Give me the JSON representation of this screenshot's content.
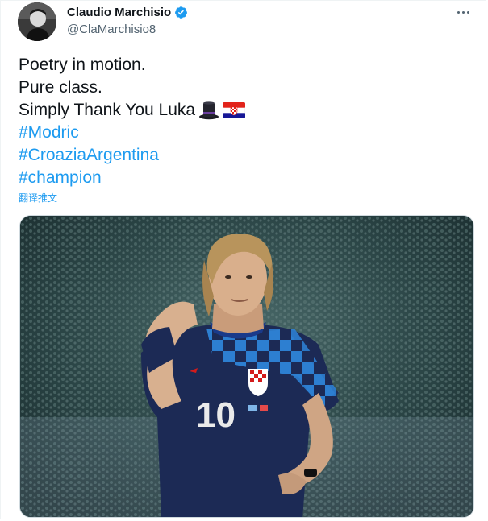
{
  "author": {
    "display_name": "Claudio Marchisio",
    "handle": "@ClaMarchisio8",
    "verified": true
  },
  "tweet": {
    "lines": [
      "Poetry in motion.",
      "Pure class.",
      "Simply Thank You Luka"
    ],
    "emojis": [
      "top-hat-icon",
      "croatia-flag-icon"
    ],
    "hashtags": [
      "#Modric",
      "#CroaziaArgentina",
      "#champion"
    ],
    "translate_label": "翻译推文"
  },
  "media": {
    "jersey_number": "10"
  },
  "colors": {
    "link": "#1d9bf0",
    "text": "#0f1419",
    "secondary": "#536471",
    "verified": "#1d9bf0"
  }
}
